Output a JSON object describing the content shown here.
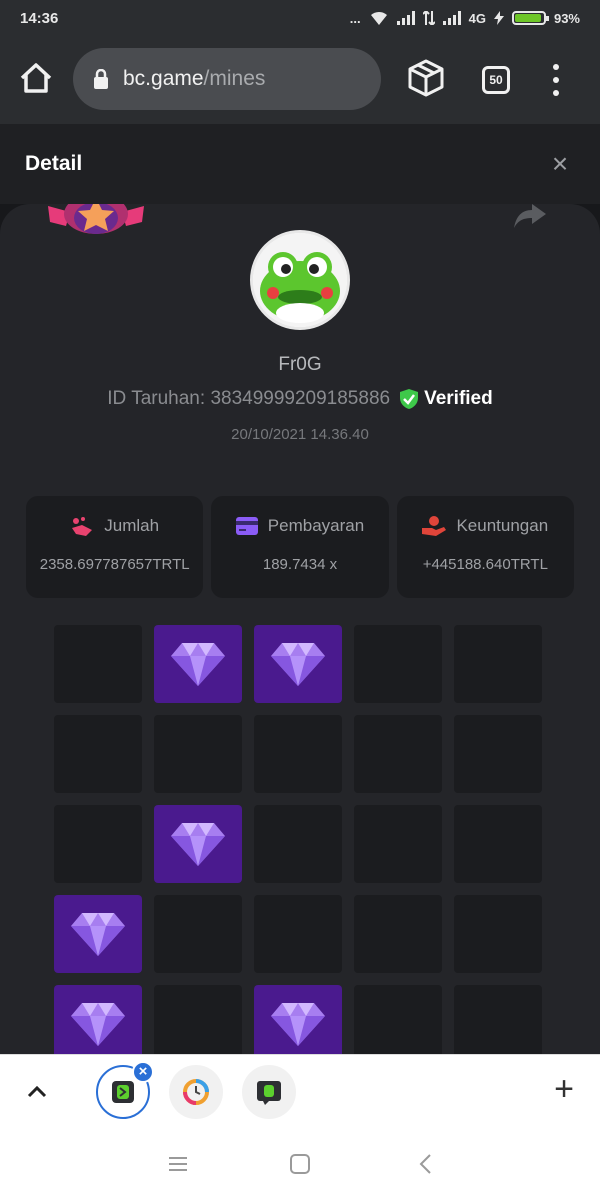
{
  "status": {
    "time": "14:36",
    "network": "4G",
    "battery": "93%",
    "battery_level": 0.93,
    "dots": "..."
  },
  "browser": {
    "domain": "bc.game",
    "path": "/mines",
    "tab_count": "50"
  },
  "detail": {
    "title": "Detail",
    "close": "×"
  },
  "bet": {
    "username": "Fr0G",
    "id_label": "ID Taruhan:",
    "id_value": "38349999209185886",
    "verified_label": "Verified",
    "date": "20/10/2021 14.36.40"
  },
  "stats": [
    {
      "label": "Jumlah",
      "value": "2358.697787657TRTL",
      "icon": "coins-hand-icon",
      "color": "#e8436f"
    },
    {
      "label": "Pembayaran",
      "value": "189.7434 x",
      "icon": "card-icon",
      "color": "#8b5cf6"
    },
    {
      "label": "Keuntungan",
      "value": "+445188.640TRTL",
      "icon": "profit-hand-icon",
      "color": "#e0453a"
    }
  ],
  "grid": {
    "rows": [
      [
        false,
        true,
        true,
        false,
        false
      ],
      [
        false,
        false,
        false,
        false,
        false
      ],
      [
        false,
        true,
        false,
        false,
        false
      ],
      [
        true,
        false,
        false,
        false,
        false
      ],
      [
        true,
        false,
        true,
        false,
        false
      ]
    ]
  },
  "tabs": {
    "close": "×",
    "new_tab": "+"
  },
  "colors": {
    "gem_bg": "#4a1a8e",
    "verified_shield": "#3ec84a",
    "accent_blue": "#2a6fd6"
  }
}
